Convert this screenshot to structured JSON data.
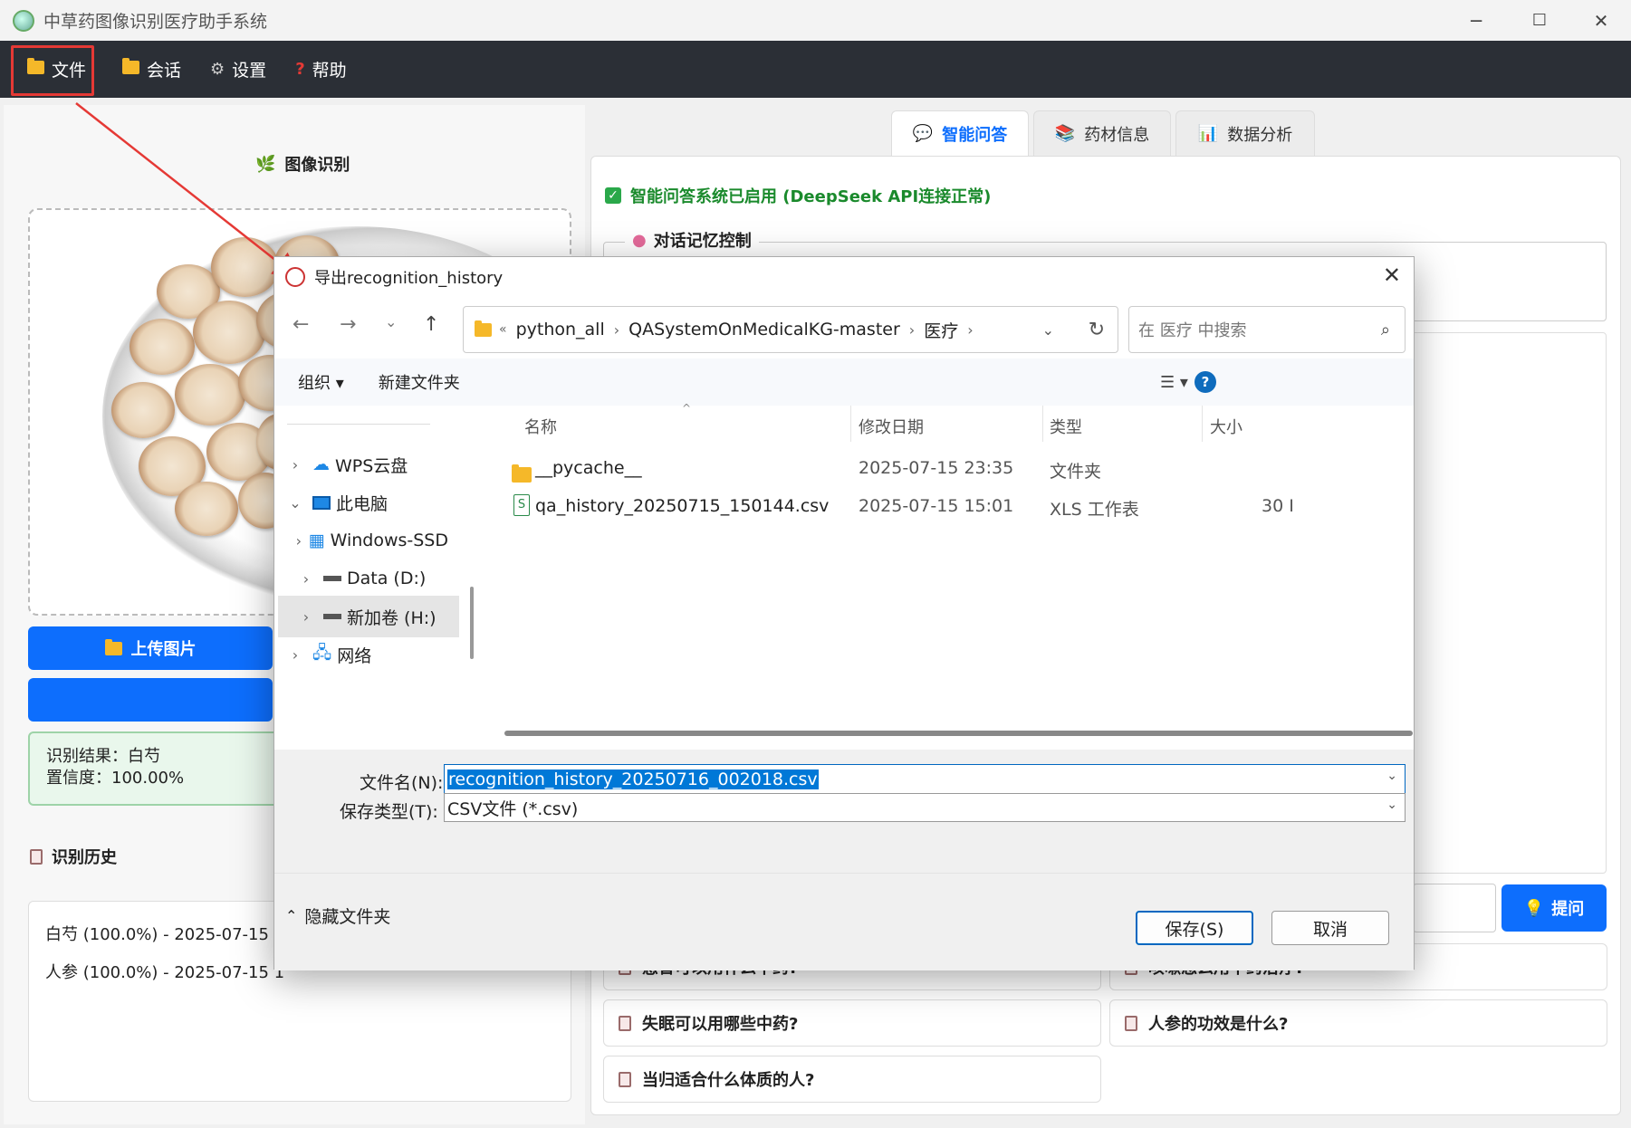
{
  "app": {
    "title": "中草药图像识别医疗助手系统"
  },
  "window_controls": {
    "minimize": "─",
    "maximize": "☐",
    "close": "✕"
  },
  "menu": [
    {
      "label": "文件",
      "icon": "folder-icon"
    },
    {
      "label": "会话",
      "icon": "folder-icon"
    },
    {
      "label": "设置",
      "icon": "gear-icon"
    },
    {
      "label": "帮助",
      "icon": "question-icon"
    }
  ],
  "left": {
    "image_title": "图像识别",
    "upload_label": "上传图片",
    "result_line1": "识别结果：白芍",
    "result_line2": "置信度：100.00%",
    "history_title": "识别历史",
    "history": [
      "白芍 (100.0%) - 2025-07-15 1",
      "人参 (100.0%) - 2025-07-15 1"
    ]
  },
  "tabs": [
    {
      "label": "智能问答",
      "icon": "speech-icon"
    },
    {
      "label": "药材信息",
      "icon": "books-icon"
    },
    {
      "label": "数据分析",
      "icon": "bar-chart-icon"
    }
  ],
  "qa": {
    "status": "智能问答系统已启用 (DeepSeek API连接正常)",
    "memory_group": "对话记忆控制",
    "ask_label": "提问",
    "suggestions": [
      "感冒可以用什么中药?",
      "咳嗽怎么用中药治疗?",
      "失眠可以用哪些中药?",
      "人参的功效是什么?",
      "当归适合什么体质的人?"
    ]
  },
  "dialog": {
    "title": "导出recognition_history",
    "breadcrumb": [
      "«",
      "python_all",
      "QASystemOnMedicalKG-master",
      "医疗"
    ],
    "search_placeholder": "在 医疗 中搜索",
    "organize": "组织 ▾",
    "new_folder": "新建文件夹",
    "nav": [
      {
        "label": "WPS云盘",
        "caret": "›"
      },
      {
        "label": "此电脑",
        "caret": "⌄"
      },
      {
        "label": "Windows-SSD",
        "caret": "›"
      },
      {
        "label": "Data (D:)",
        "caret": "›"
      },
      {
        "label": "新加卷 (H:)",
        "caret": "›"
      },
      {
        "label": "网络",
        "caret": "›"
      }
    ],
    "columns": {
      "name": "名称",
      "modified": "修改日期",
      "type": "类型",
      "size": "大小"
    },
    "files": [
      {
        "name": "__pycache__",
        "modified": "2025-07-15 23:35",
        "type": "文件夹",
        "size": ""
      },
      {
        "name": "qa_history_20250715_150144.csv",
        "modified": "2025-07-15 15:01",
        "type": "XLS 工作表",
        "size": "30 K"
      }
    ],
    "filename_label": "文件名(N):",
    "filename_value": "recognition_history_20250716_002018.csv",
    "filetype_label": "保存类型(T):",
    "filetype_value": "CSV文件 (*.csv)",
    "hide_folders": "隐藏文件夹",
    "save": "保存(S)",
    "cancel": "取消"
  }
}
